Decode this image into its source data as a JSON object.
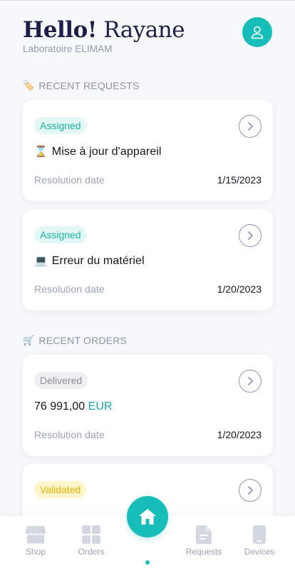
{
  "header": {
    "hello": "Hello!",
    "name": "Rayane",
    "lab": "Laboratoire ELIMAM"
  },
  "requests_section": {
    "emoji": "🏷️",
    "title": "RECENT REQUESTS",
    "items": [
      {
        "status": "Assigned",
        "emoji": "⌛",
        "title": "Mise à jour d'appareil",
        "resolution_label": "Resolution date",
        "date": "1/15/2023"
      },
      {
        "status": "Assigned",
        "emoji": "💻",
        "title": "Erreur du matériel",
        "resolution_label": "Resolution date",
        "date": "1/20/2023"
      }
    ]
  },
  "orders_section": {
    "emoji": "🛒",
    "title": "RECENT ORDERS",
    "items": [
      {
        "status": "Delivered",
        "amount": "76 991,00",
        "currency": "EUR",
        "resolution_label": "Resolution date",
        "date": "1/20/2023"
      },
      {
        "status": "Validated"
      }
    ]
  },
  "tabbar": {
    "shop": "Shop",
    "orders": "Orders",
    "requests": "Requests",
    "devices": "Devices"
  },
  "colors": {
    "accent": "#17bdb9",
    "assigned": "#19b6a4",
    "validated": "#e4b400",
    "delivered": "#8a8f98"
  }
}
